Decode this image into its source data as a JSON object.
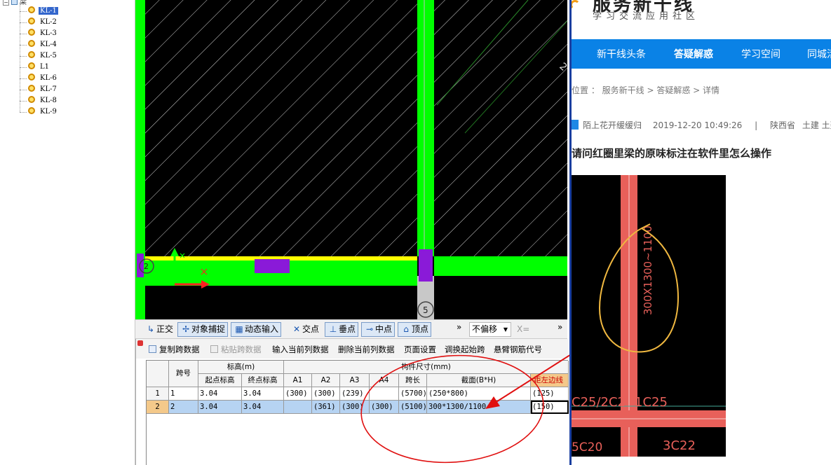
{
  "tree": {
    "root_label": "梁",
    "collapse_glyph": "−",
    "items": [
      "KL-1",
      "KL-2",
      "KL-3",
      "KL-4",
      "KL-5",
      "L1",
      "KL-6",
      "KL-7",
      "KL-8",
      "KL-9"
    ],
    "selected_index": 0
  },
  "cad": {
    "axis_marker": "5",
    "side_marker": "2",
    "corner_marker": "2",
    "colors": {
      "green": "#00ff00",
      "yellow": "#ffff00",
      "purple": "#8a1ad8",
      "red": "#ff2020"
    }
  },
  "snapbar": {
    "ortho": "正交",
    "object_snap": "对象捕捉",
    "dynamic_input": "动态输入",
    "intersection": "交点",
    "perpendicular": "垂点",
    "midpoint": "中点",
    "vertex": "顶点",
    "more": "»",
    "offset_select": "不偏移",
    "x_label": "X=",
    "more2": "»"
  },
  "table_toolbar": {
    "copy_span": "复制跨数据",
    "paste_span": "粘贴跨数据",
    "input_column": "输入当前列数据",
    "delete_column": "删除当前列数据",
    "page_setup": "页面设置",
    "swap_start": "调换起始跨",
    "cantilever": "悬臂钢筋代号"
  },
  "table": {
    "headers": {
      "span_no": "跨号",
      "elevation": "标高(m)",
      "start_elev": "起点标高",
      "end_elev": "终点标高",
      "dims": "构件尺寸(mm)",
      "a1": "A1",
      "a2": "A2",
      "a3": "A3",
      "a4": "A4",
      "span_len": "跨长",
      "section": "截面(B*H)",
      "left_dist": "距左边线"
    },
    "rows": [
      {
        "row_no": "1",
        "span": "1",
        "start": "3.04",
        "end": "3.04",
        "a1": "(300)",
        "a2": "(300)",
        "a3": "(239)",
        "a4": "",
        "len": "(5700)",
        "section": "(250*800)",
        "left": "(125)"
      },
      {
        "row_no": "2",
        "span": "2",
        "start": "3.04",
        "end": "3.04",
        "a1": "",
        "a2": "(361)",
        "a3": "(300)",
        "a4": "(300)",
        "len": "(5100)",
        "section": "300*1300/1100",
        "left": "(150)"
      }
    ]
  },
  "web": {
    "brand": "服务新干线",
    "slogan": "学习交流应用社区",
    "nav": [
      "新干线头条",
      "答疑解惑",
      "学习空间",
      "同城活动"
    ],
    "nav_active": 1,
    "breadcrumb": "位置 ： 服务新干线 > 答疑解惑 > 详情",
    "author": "陌上花开缓缓归",
    "datetime": "2019-12-20 10:49:26",
    "separator": "|",
    "region": "陕西省",
    "category": "土建 土建算量",
    "question": "请问红圈里梁的原味标注在软件里怎么操作",
    "image_labels": {
      "beam_text": "300X1300~1100",
      "rebar1": "C25/2C2",
      "rebar2": "1C25",
      "rebar3": "5C20",
      "rebar4": "3C22"
    }
  }
}
